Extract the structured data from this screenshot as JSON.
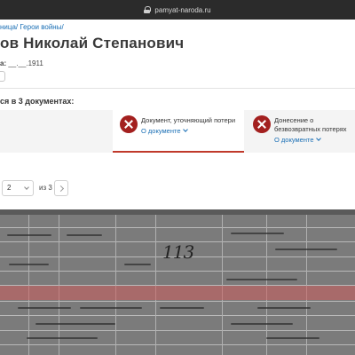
{
  "browser": {
    "url": "pamyat-naroda.ru"
  },
  "breadcrumb": {
    "item1": "ница/",
    "item2": "Герои войны/"
  },
  "person": {
    "name": "ов Николай Степанович",
    "birth_label": "а:",
    "birth_value": "__.__.1911"
  },
  "documents": {
    "heading": "ся в 3 документах:",
    "tabs": [
      {
        "title": "Документ, уточняющий потери",
        "link": "О документе"
      },
      {
        "title": "Донесение о безвозвратных потерях",
        "link": "О документе"
      }
    ]
  },
  "pager": {
    "current": "2",
    "of_label": "из 3"
  },
  "scan": {
    "mark": "113"
  },
  "colors": {
    "accent": "#a3201f",
    "link": "#1a6fb5",
    "highlight": "#cd5c5c"
  }
}
